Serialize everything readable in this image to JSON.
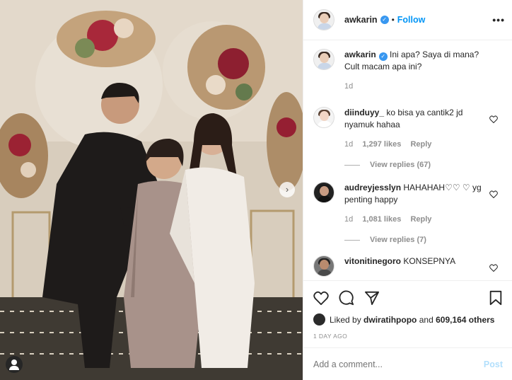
{
  "post": {
    "username": "awkarin",
    "follow_label": "Follow",
    "dot": "•",
    "more": "•••",
    "colors": {
      "accent": "#0095f6",
      "verified": "#3897f0",
      "muted": "#8e8e8e"
    }
  },
  "caption": {
    "username": "awkarin",
    "text": "Ini apa? Saya di mana? Cult macam apa ini?",
    "age": "1d"
  },
  "comments": [
    {
      "username": "diinduyy_",
      "text": "ko bisa ya cantik2 jd nyamuk hahaa",
      "age": "1d",
      "likes": "1,297 likes",
      "reply": "Reply",
      "view_replies": "View replies (67)"
    },
    {
      "username": "audreyjesslyn",
      "text": "HAHAHAH♡♡ ♡ yg penting happy",
      "age": "1d",
      "likes": "1,081 likes",
      "reply": "Reply",
      "view_replies": "View replies (7)"
    },
    {
      "username": "vitonitinegoro",
      "text": "KONSEPNYA"
    }
  ],
  "likes": {
    "prefix": "Liked by",
    "user": "dwiratihpopo",
    "mid": "and",
    "count": "609,164 others"
  },
  "timestamp": "1 DAY AGO",
  "add_comment": {
    "placeholder": "Add a comment...",
    "post_label": "Post"
  },
  "icons": [
    "heart-icon",
    "comment-icon",
    "share-icon",
    "bookmark-icon",
    "tag-user-icon",
    "chevron-right-icon"
  ]
}
